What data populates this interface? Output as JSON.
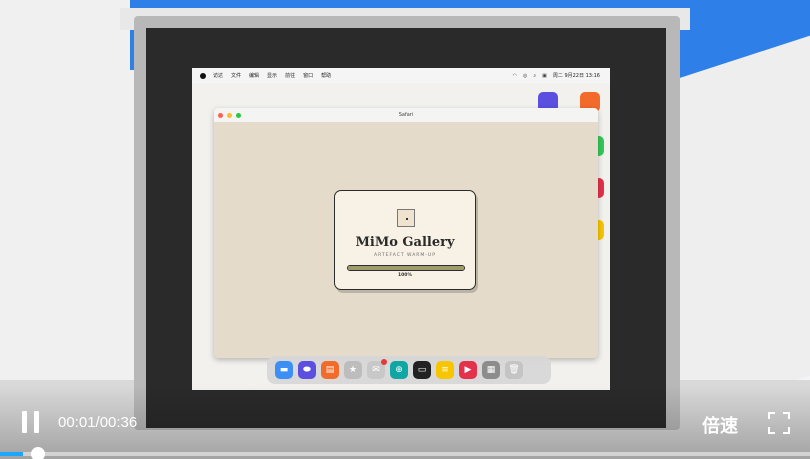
{
  "menubar": {
    "items": [
      "访达",
      "文件",
      "编辑",
      "显示",
      "前往",
      "窗口",
      "帮助"
    ],
    "clock": "周二 9月22日 13:16"
  },
  "window": {
    "title": "Safari"
  },
  "gallery": {
    "title": "MiMo Gallery",
    "subtitle": "ARTEFACT WARM-UP",
    "progress_percent": 100,
    "progress_label": "100%"
  },
  "dock": {
    "icons": [
      {
        "name": "folder-icon",
        "color": "#3b8ff5",
        "glyph": "▬"
      },
      {
        "name": "controller-icon",
        "color": "#5b4fe0",
        "glyph": "⬬"
      },
      {
        "name": "slides-icon",
        "color": "#f26b2a",
        "glyph": "▤"
      },
      {
        "name": "star-icon",
        "color": "#bdbdbd",
        "glyph": "★"
      },
      {
        "name": "mail-icon",
        "color": "#c8c8c8",
        "glyph": "✉"
      },
      {
        "name": "globe-icon",
        "color": "#10a6a4",
        "glyph": "⊕"
      },
      {
        "name": "terminal-icon",
        "color": "#222222",
        "glyph": "▭"
      },
      {
        "name": "notes-icon",
        "color": "#f7c600",
        "glyph": "≡"
      },
      {
        "name": "video-icon",
        "color": "#e4324a",
        "glyph": "▶"
      },
      {
        "name": "apps-grid-icon",
        "color": "#8c8c8c",
        "glyph": "▦"
      },
      {
        "name": "trash-icon",
        "color": "#c4c4c4",
        "glyph": "🗑"
      }
    ]
  },
  "player": {
    "time": "00:01/00:36",
    "speed_label": "倍速",
    "progress_fraction": 0.028
  },
  "colors": {
    "accent": "#1aa7ff",
    "desktop_icon_purple": "#5b4fe0",
    "desktop_icon_orange": "#f26b2a",
    "desktop_icon_green": "#34c759",
    "desktop_icon_red": "#e4324a",
    "desktop_icon_yellow": "#f7c600"
  }
}
